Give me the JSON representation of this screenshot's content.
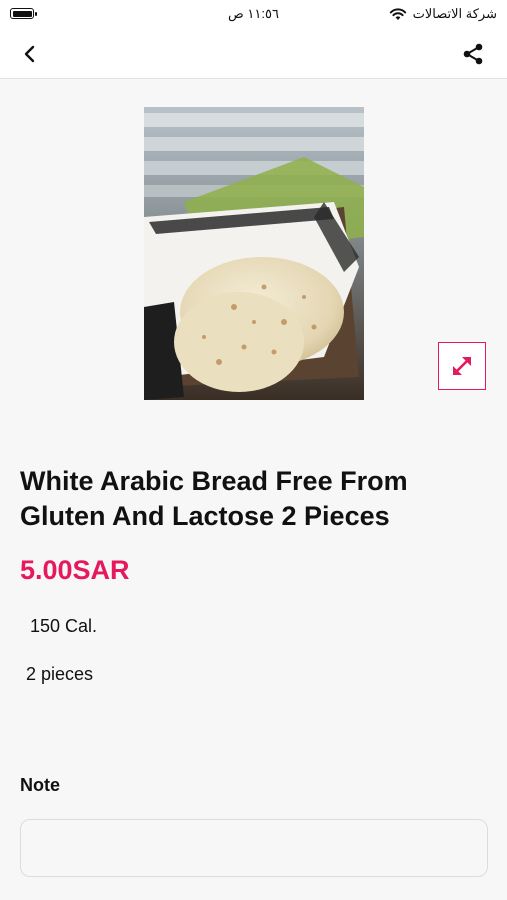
{
  "status_bar": {
    "time": "١١:٥٦ ص",
    "carrier": "شركة الاتصالات"
  },
  "product": {
    "title": "White Arabic Bread Free From Gluten And Lactose 2 Pieces",
    "price": "5.00SAR",
    "calories": "150 Cal.",
    "pieces": "2 pieces",
    "image_icon": "expand-icon"
  },
  "note": {
    "label": "Note",
    "value": "",
    "placeholder": ""
  },
  "colors": {
    "accent": "#e5195e",
    "background": "#f7f7f7"
  }
}
